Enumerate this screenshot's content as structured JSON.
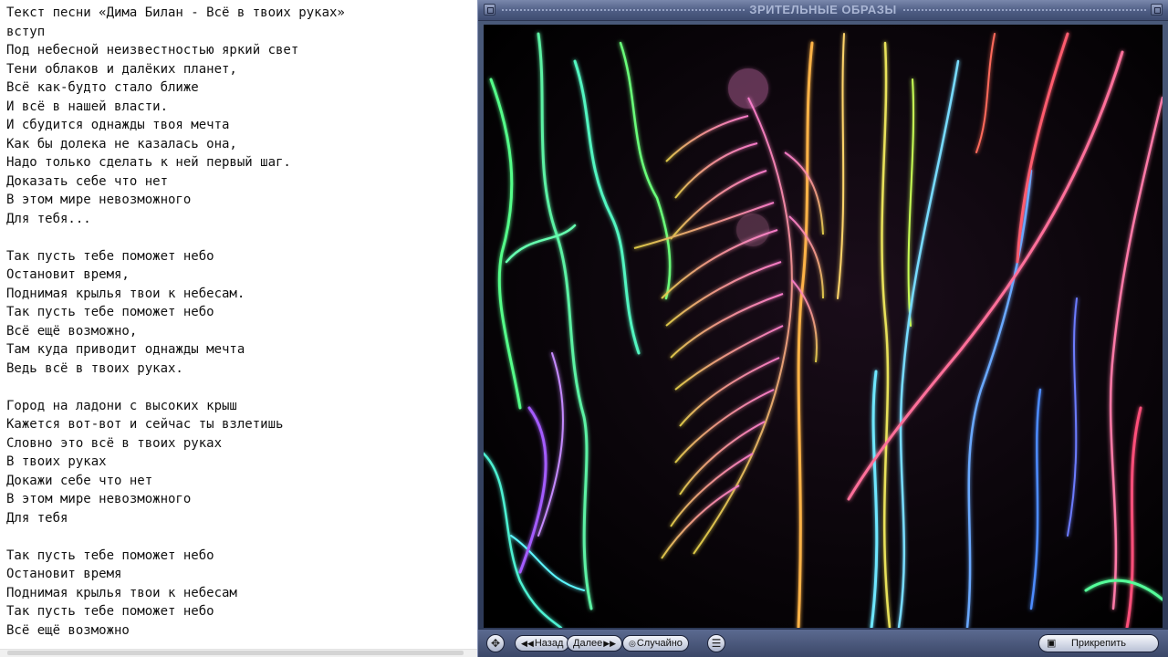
{
  "lyrics": {
    "lines": [
      "Текст песни «Дима Билан - Всё в твоих руках»",
      "вступ",
      "Под небесной неизвестностью яркий свет",
      "Тени облаков и далёких планет,",
      "Всё как-будто стало ближе",
      "И всё в нашей власти.",
      "И сбудится однажды твоя мечта",
      "Как бы долека не казалась она,",
      "Надо только сделать к ней первый шаг.",
      "Доказать себе что нет",
      "В этом мире невозможного",
      "Для тебя...",
      "",
      "Так пусть тебе поможет небо",
      "Остановит время,",
      "Поднимая крылья твои к небесам.",
      "Так пусть тебе поможет небо",
      "Всё ещё возможно,",
      "Там куда приводит однажды мечта",
      "Ведь всё в твоих руках.",
      "",
      "Город на ладони с высоких крыш",
      "Кажется вот-вот и сейчас ты взлетишь",
      "Словно это всё в твоих руках",
      "В твоих руках",
      "Докажи себе что нет",
      "В этом мире невозможного",
      "Для тебя",
      "",
      "Так пусть тебе поможет небо",
      "Остановит время",
      "Поднимая крылья твои к небесам",
      "Так пусть тебе поможет небо",
      "Всё ещё возможно"
    ]
  },
  "player": {
    "title": "ЗРИТЕЛЬНЫЕ ОБРАЗЫ",
    "controls": {
      "back_label": "Назад",
      "next_label": "Далее",
      "random_label": "Случайно",
      "attach_label": "Прикрепить"
    },
    "icons": {
      "back": "double-left-arrow",
      "next": "double-right-arrow",
      "random": "random-icon",
      "menu": "menu-icon",
      "move": "move-icon",
      "attach": "attach-icon"
    },
    "colors": {
      "frame": "#3e4c70",
      "title_text": "#aab6d4"
    }
  }
}
